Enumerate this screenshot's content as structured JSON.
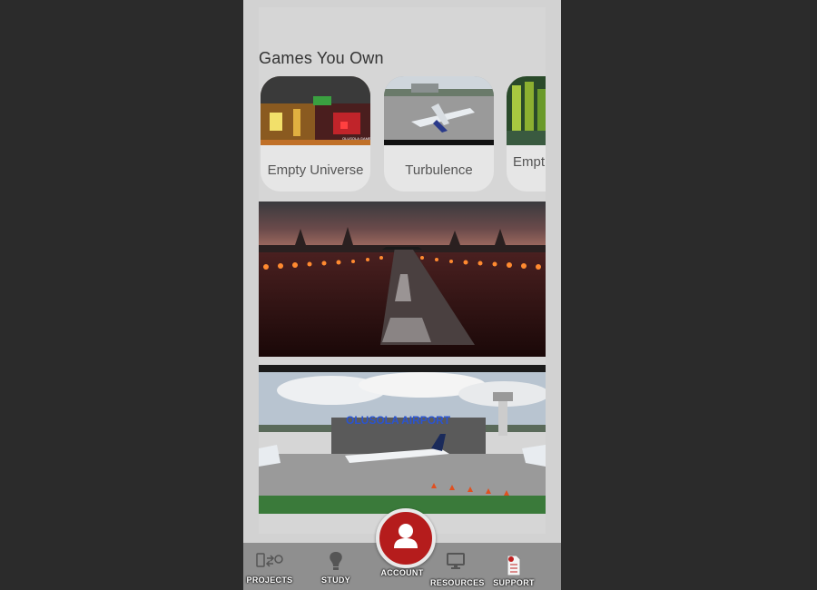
{
  "section": {
    "title": "Games You Own"
  },
  "games": [
    {
      "label": "Empty Universe"
    },
    {
      "label": "Turbulence"
    },
    {
      "label": "Empt"
    }
  ],
  "banners": {
    "runway": {
      "icon": "runway-night-image"
    },
    "airport": {
      "icon": "airport-image",
      "sign_text": "OLUSOLA AIRPORT"
    }
  },
  "nav": {
    "projects": "PROJECTS",
    "study": "STUDY",
    "account": "ACCOUNT",
    "resources": "RESOURCES",
    "support": "SUPPORT"
  },
  "colors": {
    "accent": "#b51c1c",
    "nav_bg": "#8f8f8f",
    "card_bg": "#e6e6e6"
  }
}
